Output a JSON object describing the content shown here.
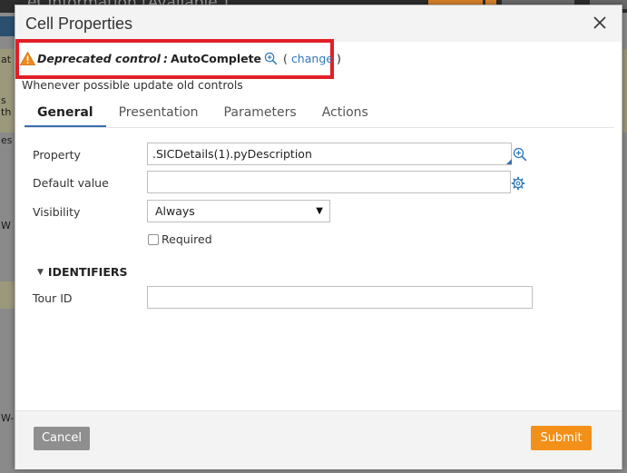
{
  "background": {
    "title": "eCInformation [Available ]",
    "left_fragments": [
      "at",
      "s th",
      "es",
      "W",
      "W-"
    ]
  },
  "dialog": {
    "title": "Cell Properties",
    "deprecated": {
      "label": "Deprecated control",
      "separator": ":",
      "value": "AutoComplete",
      "paren_open": "(",
      "change_link": "change",
      "paren_close": ")"
    },
    "info": "Whenever possible update old controls",
    "tabs": [
      {
        "label": "General"
      },
      {
        "label": "Presentation"
      },
      {
        "label": "Parameters"
      },
      {
        "label": "Actions"
      }
    ],
    "fields": {
      "property": {
        "label": "Property",
        "value": ".SICDetails(1).pyDescription"
      },
      "default_value": {
        "label": "Default value",
        "value": ""
      },
      "visibility": {
        "label": "Visibility",
        "selected": "Always"
      },
      "required": {
        "label": "Required",
        "checked": false
      }
    },
    "identifiers": {
      "header": "IDENTIFIERS",
      "tour_id": {
        "label": "Tour ID",
        "value": ""
      }
    },
    "footer": {
      "cancel": "Cancel",
      "submit": "Submit"
    }
  },
  "colors": {
    "accent": "#f39019",
    "link": "#2e78b7",
    "highlight_box": "#e21f26",
    "tab_underline": "#3a6fb0",
    "cancel_bg": "#8f8f8f"
  },
  "icons": {
    "warning": "warning-icon",
    "zoom": "zoom-in-icon",
    "gear": "gear-icon",
    "close": "close-icon"
  }
}
